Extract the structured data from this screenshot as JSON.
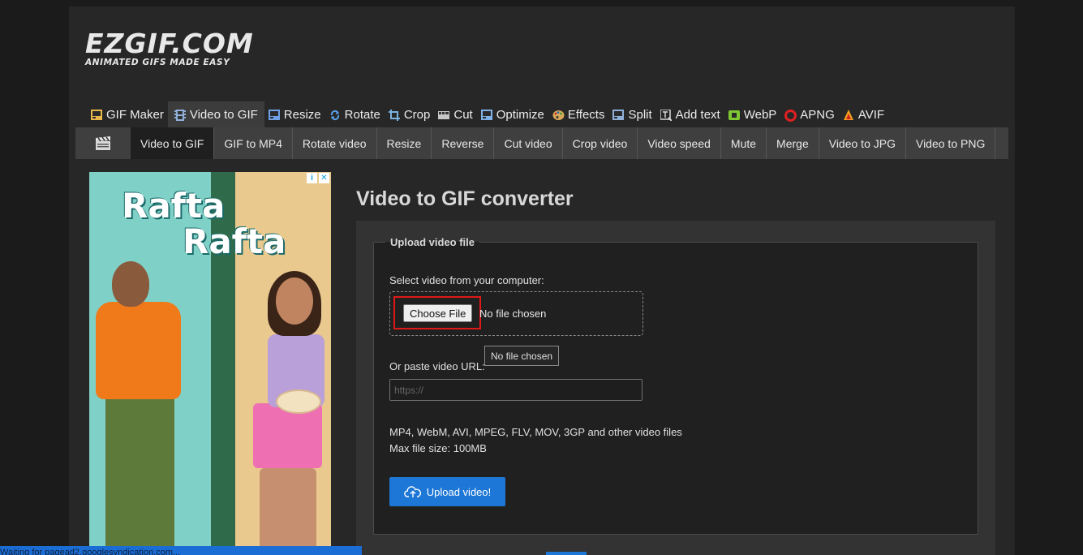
{
  "logo": {
    "main": "EZGIF.COM",
    "tagline": "ANIMATED GIFS MADE EASY"
  },
  "main_nav": [
    {
      "label": "GIF Maker",
      "icon": "gif-maker-icon",
      "color": "#e8b84a"
    },
    {
      "label": "Video to GIF",
      "icon": "film-icon",
      "color": "#8fb0d8",
      "active": true
    },
    {
      "label": "Resize",
      "icon": "resize-icon",
      "color": "#6fa0e8"
    },
    {
      "label": "Rotate",
      "icon": "rotate-icon",
      "color": "#5aa0e8"
    },
    {
      "label": "Crop",
      "icon": "crop-icon",
      "color": "#7ab0e0"
    },
    {
      "label": "Cut",
      "icon": "cut-icon",
      "color": "#c8c8c8"
    },
    {
      "label": "Optimize",
      "icon": "optimize-icon",
      "color": "#7fb0e8"
    },
    {
      "label": "Effects",
      "icon": "palette-icon",
      "color": "#d8a85a"
    },
    {
      "label": "Split",
      "icon": "split-icon",
      "color": "#8fb0d8"
    },
    {
      "label": "Add text",
      "icon": "add-text-icon",
      "color": "#d8d8d8"
    },
    {
      "label": "WebP",
      "icon": "webp-icon",
      "color": "#7ec833"
    },
    {
      "label": "APNG",
      "icon": "apng-icon",
      "color": "#e02020"
    },
    {
      "label": "AVIF",
      "icon": "avif-icon",
      "color": "#f0a020"
    }
  ],
  "sub_nav": [
    {
      "label": "Video to GIF",
      "active": true
    },
    {
      "label": "GIF to MP4"
    },
    {
      "label": "Rotate video"
    },
    {
      "label": "Resize"
    },
    {
      "label": "Reverse"
    },
    {
      "label": "Cut video"
    },
    {
      "label": "Crop video"
    },
    {
      "label": "Video speed"
    },
    {
      "label": "Mute"
    },
    {
      "label": "Merge"
    },
    {
      "label": "Video to JPG"
    },
    {
      "label": "Video to PNG"
    }
  ],
  "ad": {
    "title_line1": "Rafta",
    "title_line2": "Rafta",
    "badge_info": "i",
    "badge_close": "✕"
  },
  "content": {
    "title": "Video to GIF converter",
    "legend": "Upload video file",
    "select_label": "Select video from your computer:",
    "choose_button": "Choose File",
    "no_file": "No file chosen",
    "tooltip": "No file chosen",
    "url_label": "Or paste video URL:",
    "url_placeholder": "https://",
    "formats": "MP4, WebM, AVI, MPEG, FLV, MOV, 3GP and other video files",
    "max_size": "Max file size: 100MB",
    "upload_button": "Upload video!"
  },
  "status_bar": {
    "text": "Waiting for pagead2.googlesyndication.com..."
  }
}
